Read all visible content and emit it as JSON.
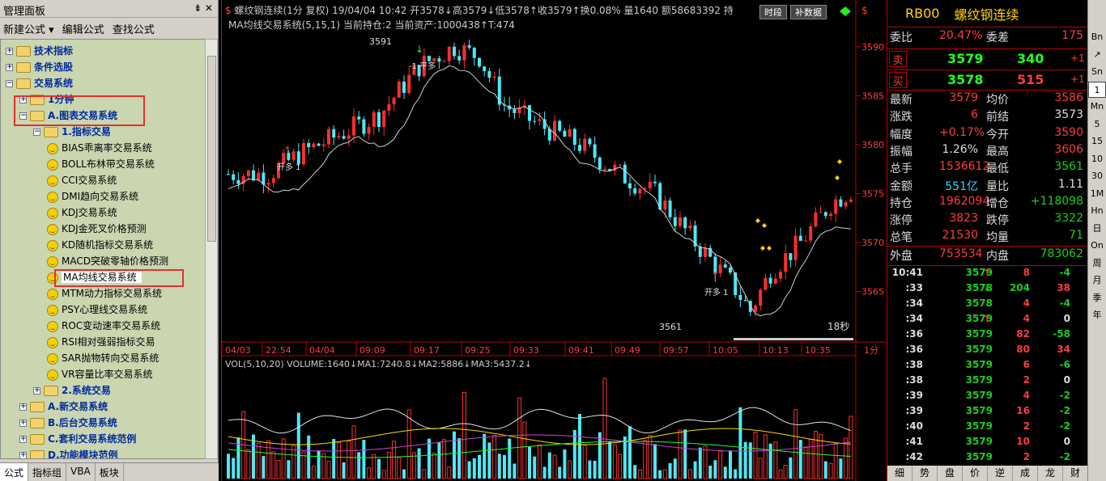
{
  "left": {
    "title": "管理面板",
    "pin": "⇟ ✕",
    "menu": [
      "新建公式 ▾",
      "编辑公式",
      "查找公式"
    ],
    "tree": [
      {
        "label": "技术指标",
        "level": 0,
        "exp": "+",
        "type": "folder"
      },
      {
        "label": "条件选股",
        "level": 0,
        "exp": "+",
        "type": "folder"
      },
      {
        "label": "交易系统",
        "level": 0,
        "exp": "−",
        "type": "folder"
      },
      {
        "label": "1分钟",
        "level": 1,
        "exp": "+",
        "type": "folder"
      },
      {
        "label": "A.图表交易系统",
        "level": 1,
        "exp": "−",
        "type": "folder"
      },
      {
        "label": "1.指标交易",
        "level": 2,
        "exp": "−",
        "type": "folder"
      },
      {
        "label": "BIAS乖离率交易系统",
        "level": 3,
        "type": "smile"
      },
      {
        "label": "BOLL布林带交易系统",
        "level": 3,
        "type": "smile"
      },
      {
        "label": "CCI交易系统",
        "level": 3,
        "type": "smile"
      },
      {
        "label": "DMI趋向交易系统",
        "level": 3,
        "type": "smile"
      },
      {
        "label": "KDJ交易系统",
        "level": 3,
        "type": "smile"
      },
      {
        "label": "KDJ金死叉价格预测",
        "level": 3,
        "type": "smile"
      },
      {
        "label": "KD随机指标交易系统",
        "level": 3,
        "type": "smile"
      },
      {
        "label": "MACD突破零轴价格预测",
        "level": 3,
        "type": "smile"
      },
      {
        "label": "MA均线交易系统",
        "level": 3,
        "type": "smile",
        "selected": true
      },
      {
        "label": "MTM动力指标交易系统",
        "level": 3,
        "type": "smile"
      },
      {
        "label": "PSY心理线交易系统",
        "level": 3,
        "type": "smile"
      },
      {
        "label": "ROC变动速率交易系统",
        "level": 3,
        "type": "smile"
      },
      {
        "label": "RSI相对强弱指标交易",
        "level": 3,
        "type": "smile"
      },
      {
        "label": "SAR抛物转向交易系统",
        "level": 3,
        "type": "smile"
      },
      {
        "label": "VR容量比率交易系统",
        "level": 3,
        "type": "smile"
      },
      {
        "label": "2.系统交易",
        "level": 2,
        "exp": "+",
        "type": "folder"
      },
      {
        "label": "A.新交易系统",
        "level": 1,
        "exp": "+",
        "type": "folder"
      },
      {
        "label": "B.后台交易系统",
        "level": 1,
        "exp": "+",
        "type": "folder"
      },
      {
        "label": "C.套利交易系统范例",
        "level": 1,
        "exp": "+",
        "type": "folder"
      },
      {
        "label": "D.功能模块范例",
        "level": 1,
        "exp": "+",
        "type": "folder"
      }
    ],
    "tabs": [
      "公式",
      "指标组",
      "VBA",
      "板块"
    ]
  },
  "chart": {
    "header": "螺纹钢连续(1分 复权) 19/04/04 10:42 开3578↓高3579↓低3578↑收3579↑换0.08% 量1640 额58683392 持",
    "buttons": [
      "时段",
      "补数据"
    ],
    "header2": "MA均线交易系统(5,15,1)  当前持仓:2 当前资产:1000438↑T:474",
    "y_ticks": [
      "3590",
      "3585",
      "3580",
      "3575",
      "3570",
      "3565"
    ],
    "x_ticks": [
      "04/03",
      "22:54",
      "04/04",
      "09:09",
      "09:17",
      "09:25",
      "09:33",
      "09:41",
      "09:49",
      "09:57",
      "10:05",
      "10:13",
      "10:35"
    ],
    "x_unit": "1分",
    "high_label": "3591",
    "low_label": "3561",
    "countdown": "18秒",
    "signals": [
      {
        "text": "开多 1"
      },
      {
        "text": "-1 平多"
      },
      {
        "text": "开多 1"
      }
    ],
    "vol_header": "VOL(5,10,20) VOLUME:1640↓MA1:7240.8↓MA2:5886↓MA3:5437.2↓"
  },
  "chart_data": {
    "type": "candlestick",
    "title": "螺纹钢连续(1分 复权)",
    "yrange": [
      3560,
      3592
    ],
    "last": 3579,
    "high": 3591,
    "low": 3561
  },
  "quote": {
    "code": "RB00",
    "name": "螺纹钢连续",
    "weibi": {
      "label": "委比",
      "value": "20.47%"
    },
    "weicha": {
      "label": "委差",
      "value": "175"
    },
    "sell": {
      "label": "卖",
      "price": "3579",
      "vol": "340",
      "chg": "+1"
    },
    "buy": {
      "label": "买",
      "price": "3578",
      "vol": "515",
      "chg": "+1"
    },
    "stats": [
      [
        "最新",
        "3579",
        "均价",
        "3586"
      ],
      [
        "涨跌",
        "6",
        "前结",
        "3573"
      ],
      [
        "幅度",
        "+0.17%",
        "今开",
        "3590"
      ],
      [
        "振幅",
        "1.26%",
        "最高",
        "3606"
      ],
      [
        "总手",
        "1536612",
        "最低",
        "3561"
      ],
      [
        "金额",
        "551亿",
        "量比",
        "1.11"
      ],
      [
        "持仓",
        "1962094",
        "增仓",
        "+118098"
      ],
      [
        "涨停",
        "3823",
        "跌停",
        "3322"
      ],
      [
        "总笔",
        "21530",
        "均量",
        "71"
      ]
    ],
    "outer": {
      "label": "外盘",
      "value": "753534"
    },
    "inner": {
      "label": "内盘",
      "value": "783062"
    },
    "ticks": [
      [
        "10:41",
        "3579",
        "↑",
        "8",
        "-4"
      ],
      [
        ":33",
        "3578",
        "↓",
        "204",
        "38"
      ],
      [
        ":34",
        "3578",
        "",
        "4",
        "-4"
      ],
      [
        ":34",
        "3579",
        "↑",
        "4",
        "0"
      ],
      [
        ":36",
        "3579",
        "",
        "82",
        "-58"
      ],
      [
        ":36",
        "3579",
        "",
        "80",
        "34"
      ],
      [
        ":38",
        "3579",
        "",
        "6",
        "-6"
      ],
      [
        ":38",
        "3579",
        "",
        "2",
        "0"
      ],
      [
        ":39",
        "3579",
        "",
        "4",
        "-2"
      ],
      [
        ":39",
        "3579",
        "",
        "16",
        "-2"
      ],
      [
        ":40",
        "3579",
        "",
        "2",
        "-2"
      ],
      [
        ":41",
        "3579",
        "",
        "10",
        "0"
      ],
      [
        ":42",
        "3579",
        "",
        "2",
        "-2"
      ]
    ],
    "tabs": [
      "细",
      "势",
      "盘",
      "价",
      "逆",
      "成",
      "龙",
      "财"
    ]
  },
  "toolbar": [
    "Bn",
    "↗",
    "Sn",
    "1",
    "Mn",
    "5",
    "15",
    "10",
    "30",
    "1M",
    "Hn",
    "日",
    "On",
    "周",
    "月",
    "季",
    "年"
  ]
}
